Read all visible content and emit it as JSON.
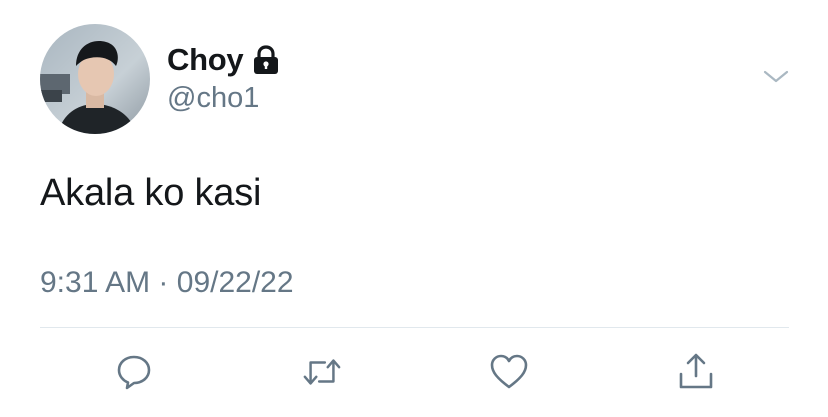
{
  "tweet": {
    "display_name": "Choy",
    "handle": "@cho1",
    "text": "Akala ko kasi",
    "time": "9:31 AM",
    "separator": "·",
    "date": "09/22/22",
    "protected": true
  },
  "icons": {
    "lock": "lock-icon",
    "more": "chevron-down-icon",
    "reply": "reply-icon",
    "retweet": "retweet-icon",
    "like": "heart-icon",
    "share": "share-icon"
  },
  "colors": {
    "text_primary": "#14171a",
    "text_secondary": "#657786",
    "divider": "#e1e8ed",
    "icon": "#657786"
  }
}
